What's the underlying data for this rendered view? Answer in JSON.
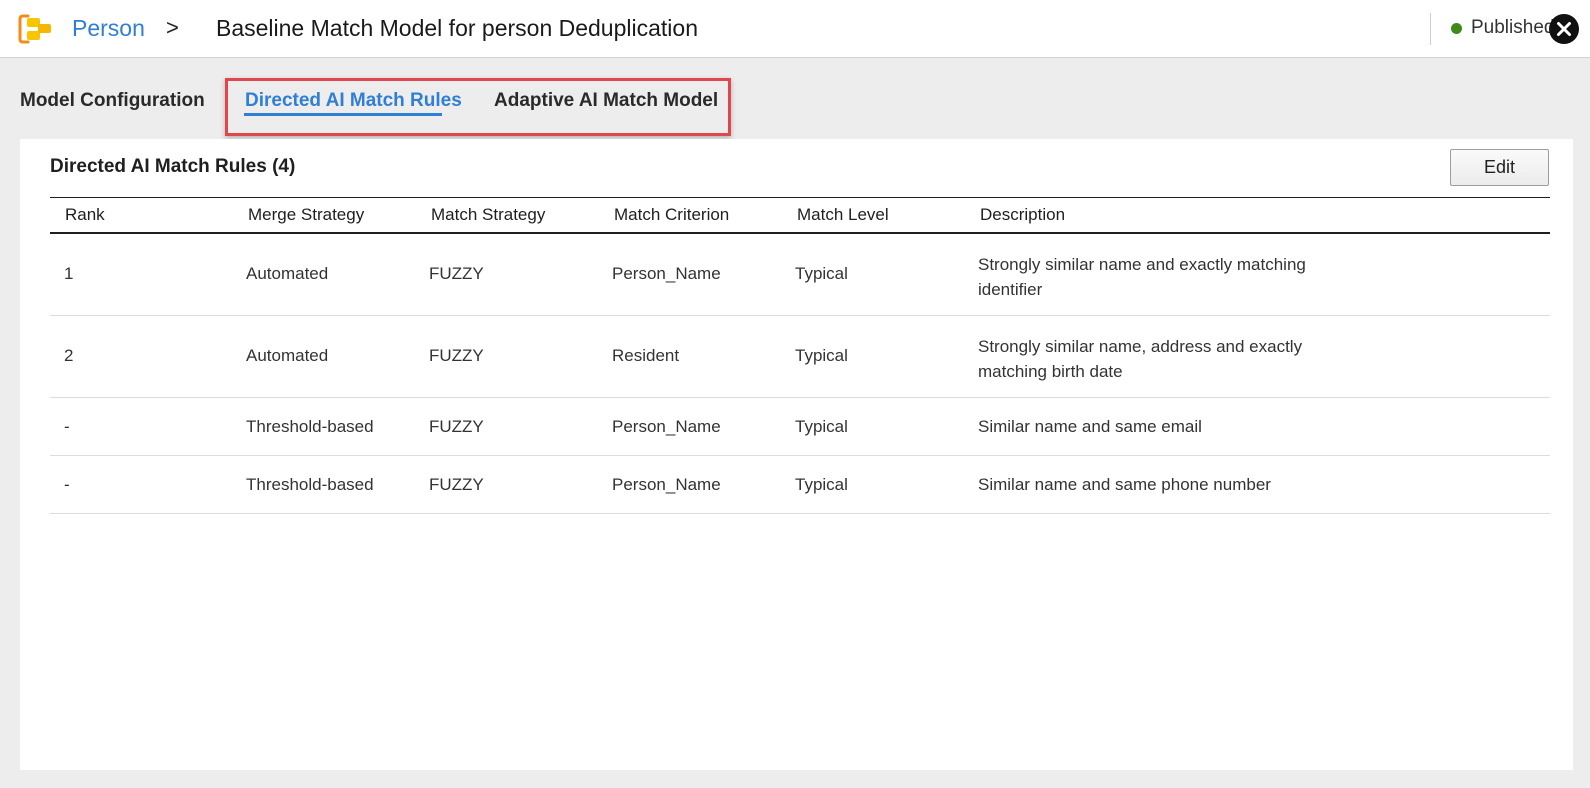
{
  "header": {
    "breadcrumb_link": "Person",
    "breadcrumb_separator": ">",
    "title": "Baseline Match Model for person Deduplication",
    "status": "Published",
    "logo_icon": "entity-logo-icon",
    "close_icon": "close-icon"
  },
  "tabs": [
    {
      "label": "Model Configuration",
      "active": false
    },
    {
      "label": "Directed AI Match Rules",
      "active": true
    },
    {
      "label": "Adaptive AI Match Model",
      "active": false
    }
  ],
  "panel": {
    "title": "Directed AI Match Rules (4)",
    "edit_label": "Edit"
  },
  "table": {
    "columns": [
      "Rank",
      "Merge Strategy",
      "Match Strategy",
      "Match Criterion",
      "Match Level",
      "Description"
    ],
    "rows": [
      {
        "rank": "1",
        "merge": "Automated",
        "match": "FUZZY",
        "criterion": "Person_Name",
        "level": "Typical",
        "description": "Strongly similar name and exactly matching identifier"
      },
      {
        "rank": "2",
        "merge": "Automated",
        "match": "FUZZY",
        "criterion": "Resident",
        "level": "Typical",
        "description": "Strongly similar name, address and exactly matching birth date"
      },
      {
        "rank": "-",
        "merge": "Threshold-based",
        "match": "FUZZY",
        "criterion": "Person_Name",
        "level": "Typical",
        "description": "Similar name and same email"
      },
      {
        "rank": "-",
        "merge": "Threshold-based",
        "match": "FUZZY",
        "criterion": "Person_Name",
        "level": "Typical",
        "description": "Similar name and same phone number"
      }
    ]
  },
  "colors": {
    "accent": "#2f7fd6",
    "status_published": "#3f8a1b",
    "highlight_border": "#e0474c",
    "logo_orange": "#f28c1b",
    "logo_yellow": "#f7c600"
  }
}
